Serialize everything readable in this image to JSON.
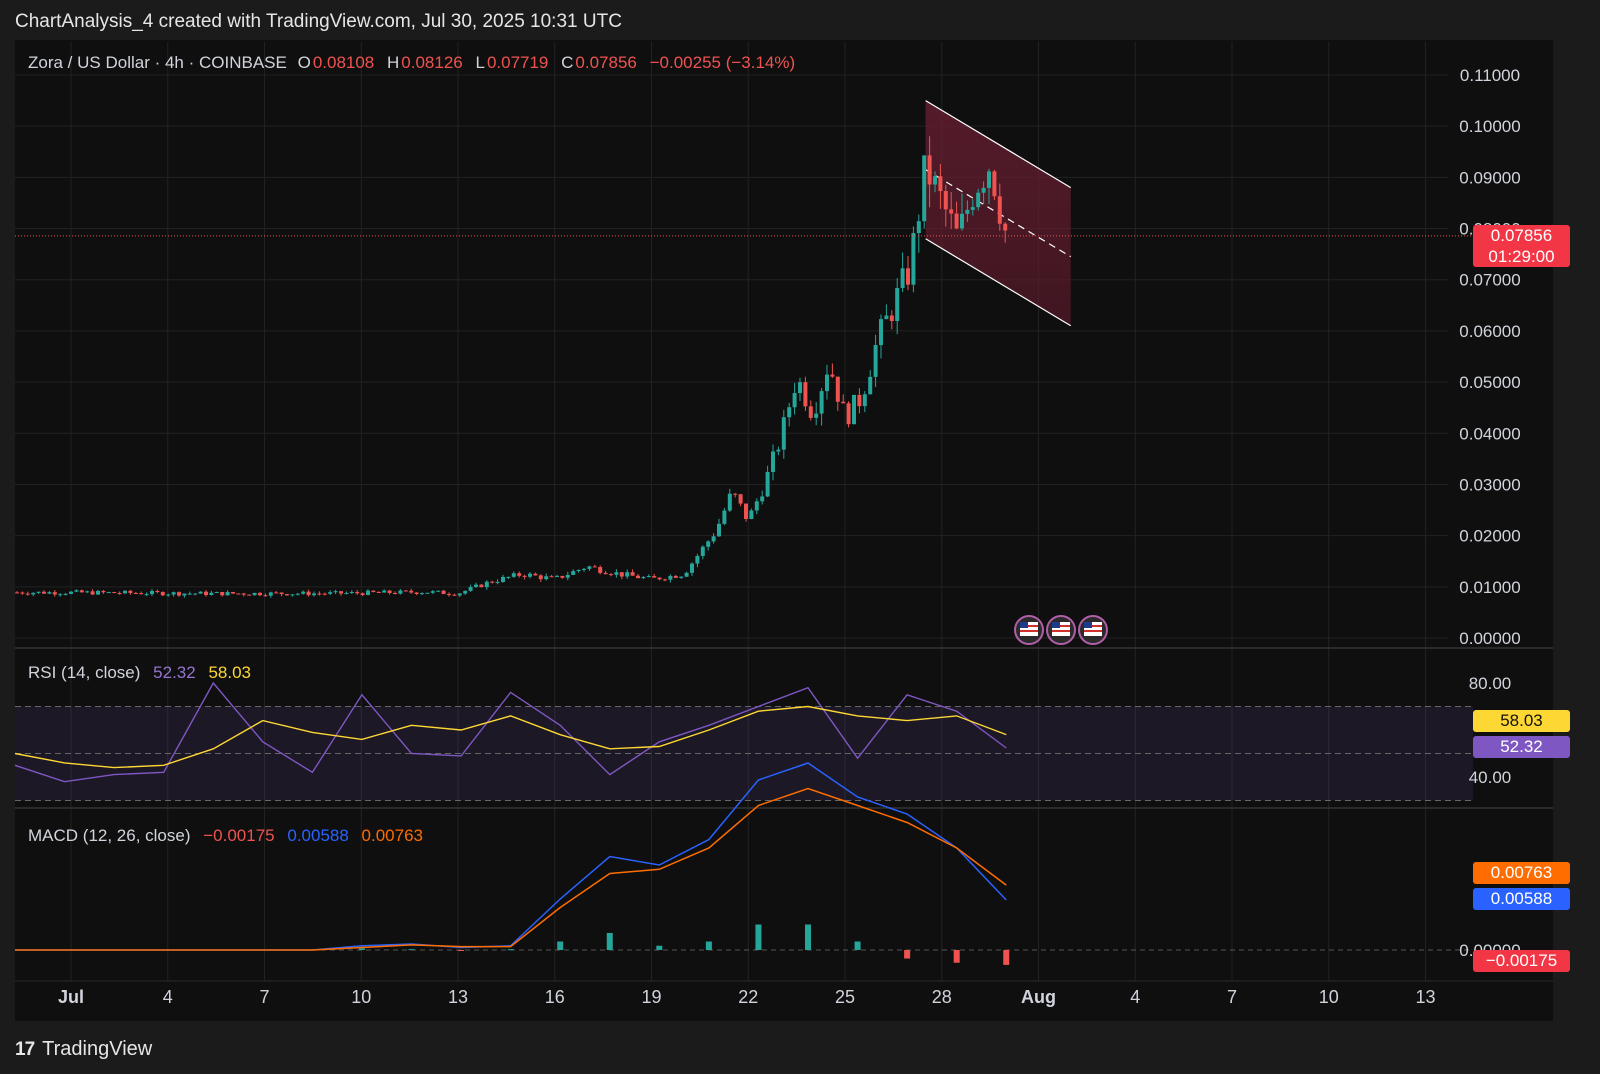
{
  "header": {
    "title": "ChartAnalysis_4 created with TradingView.com, Jul 30, 2025 10:31 UTC"
  },
  "legend": {
    "symbol": "Zora / US Dollar · 4h · COINBASE",
    "o_label": "O",
    "o_value": "0.08108",
    "h_label": "H",
    "h_value": "0.08126",
    "l_label": "L",
    "l_value": "0.07719",
    "c_label": "C",
    "c_value": "0.07856",
    "change": "−0.00255 (−3.14%)"
  },
  "rsi_legend": {
    "label": "RSI (14, close)",
    "rsi": "52.32",
    "ma": "58.03"
  },
  "macd_legend": {
    "label": "MACD (12, 26, close)",
    "hist": "−0.00175",
    "macd": "0.00588",
    "signal": "0.00763"
  },
  "price_tags": {
    "last": "0.07856",
    "countdown": "01:29:00"
  },
  "rsi_tags": {
    "ma": "58.03",
    "rsi": "52.32"
  },
  "macd_tags": {
    "signal": "0.00763",
    "macd": "0.00588",
    "hist": "−0.00175"
  },
  "footer": {
    "brand": "TradingView"
  },
  "colors": {
    "up": "#26a69a",
    "down": "#ef5350",
    "rsi": "#7e57c2",
    "rsi_ma": "#fdd835",
    "macd": "#2962ff",
    "signal": "#ff6d00",
    "channel": "#6d1f33"
  },
  "chart_data": [
    {
      "type": "candlestick",
      "title": "Zora / US Dollar · 4h · COINBASE",
      "y_ticks": [
        "0.11000",
        "0.10000",
        "0.09000",
        "0.08000",
        "0.07000",
        "0.06000",
        "0.05000",
        "0.04000",
        "0.03000",
        "0.02000",
        "0.01000",
        "0.00000"
      ],
      "x_ticks": [
        "Jul",
        "4",
        "7",
        "10",
        "13",
        "16",
        "19",
        "22",
        "25",
        "28",
        "Aug",
        "4",
        "7",
        "10",
        "13"
      ],
      "ylim": [
        0,
        0.11
      ],
      "last_price": 0.07856,
      "close_path": [
        {
          "date": "2025-07-01",
          "close": 0.0089
        },
        {
          "date": "2025-07-05",
          "close": 0.0087
        },
        {
          "date": "2025-07-09",
          "close": 0.0087
        },
        {
          "date": "2025-07-12",
          "close": 0.009
        },
        {
          "date": "2025-07-13",
          "close": 0.0087
        },
        {
          "date": "2025-07-14",
          "close": 0.011
        },
        {
          "date": "2025-07-15",
          "close": 0.0125
        },
        {
          "date": "2025-07-16",
          "close": 0.0115
        },
        {
          "date": "2025-07-17",
          "close": 0.014
        },
        {
          "date": "2025-07-18",
          "close": 0.0125
        },
        {
          "date": "2025-07-19",
          "close": 0.0115
        },
        {
          "date": "2025-07-20",
          "close": 0.0125
        },
        {
          "date": "2025-07-21",
          "close": 0.021
        },
        {
          "date": "2025-07-21T12:00",
          "close": 0.0285
        },
        {
          "date": "2025-07-22",
          "close": 0.023
        },
        {
          "date": "2025-07-22T12:00",
          "close": 0.03
        },
        {
          "date": "2025-07-23",
          "close": 0.039
        },
        {
          "date": "2025-07-23T12:00",
          "close": 0.051
        },
        {
          "date": "2025-07-24",
          "close": 0.044
        },
        {
          "date": "2025-07-24T12:00",
          "close": 0.054
        },
        {
          "date": "2025-07-25",
          "close": 0.043
        },
        {
          "date": "2025-07-25T12:00",
          "close": 0.047
        },
        {
          "date": "2025-07-26",
          "close": 0.058
        },
        {
          "date": "2025-07-27",
          "close": 0.072
        },
        {
          "date": "2025-07-27T12:00",
          "close": 0.092
        },
        {
          "date": "2025-07-28",
          "close": 0.085
        },
        {
          "date": "2025-07-28T12:00",
          "close": 0.078
        },
        {
          "date": "2025-07-29",
          "close": 0.088
        },
        {
          "date": "2025-07-29T12:00",
          "close": 0.093
        },
        {
          "date": "2025-07-30",
          "close": 0.0786
        }
      ],
      "channel": {
        "start": "2025-07-27T12:00",
        "end": "2025-08-01T00:00",
        "upper": [
          0.105,
          0.088
        ],
        "lower": [
          0.078,
          0.061
        ],
        "mid": [
          0.0915,
          0.0745
        ]
      }
    },
    {
      "type": "line",
      "title": "RSI (14, close)",
      "y_ticks": [
        "80.00",
        "40.00"
      ],
      "bands": [
        70,
        30
      ],
      "series": [
        {
          "name": "RSI",
          "values": [
            45,
            38,
            41,
            42,
            80,
            55,
            42,
            75,
            50,
            49,
            76,
            62,
            41,
            55,
            62,
            70,
            78,
            48,
            75,
            68,
            52.32
          ]
        },
        {
          "name": "RSI-based MA",
          "values": [
            50,
            46,
            44,
            45,
            52,
            64,
            59,
            56,
            62,
            60,
            66,
            58,
            52,
            53,
            60,
            68,
            70,
            66,
            64,
            66,
            58.03
          ]
        }
      ]
    },
    {
      "type": "line",
      "title": "MACD (12, 26, close)",
      "y_ticks": [
        "0.00000"
      ],
      "series": [
        {
          "name": "MACD",
          "values": [
            0,
            0,
            0,
            0,
            0,
            0,
            0,
            0.0005,
            0.0007,
            0.0003,
            0.0005,
            0.006,
            0.011,
            0.01,
            0.013,
            0.02,
            0.022,
            0.018,
            0.016,
            0.012,
            0.00588
          ]
        },
        {
          "name": "Signal",
          "values": [
            0,
            0,
            0,
            0,
            0,
            0,
            0,
            0.0003,
            0.0006,
            0.0004,
            0.0004,
            0.005,
            0.009,
            0.0095,
            0.012,
            0.017,
            0.019,
            0.017,
            0.015,
            0.012,
            0.00763
          ]
        },
        {
          "name": "Histogram",
          "values": [
            0,
            0,
            0,
            0,
            0,
            0,
            0,
            0.0002,
            0.0001,
            -0.0001,
            0.0001,
            0.001,
            0.002,
            0.0005,
            0.001,
            0.003,
            0.003,
            0.001,
            -0.001,
            -0.0015,
            -0.00175
          ]
        }
      ]
    }
  ]
}
